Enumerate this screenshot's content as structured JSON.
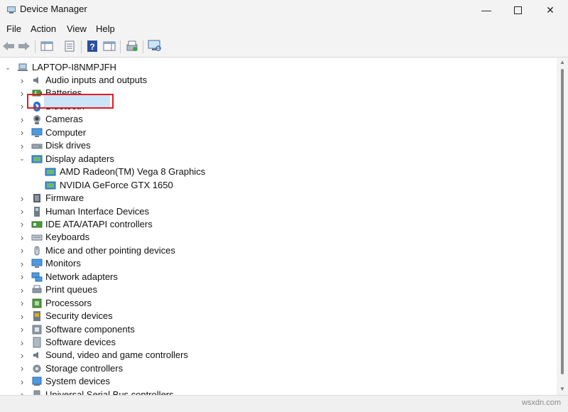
{
  "window": {
    "title": "Device Manager"
  },
  "menu": [
    "File",
    "Action",
    "View",
    "Help"
  ],
  "tree": {
    "root": "LAPTOP-I8NMPJFH",
    "categories": [
      {
        "label": "Audio inputs and outputs",
        "icon": "speaker-icon"
      },
      {
        "label": "Batteries",
        "icon": "battery-icon"
      },
      {
        "label": "Bluetooth",
        "icon": "bluetooth-icon"
      },
      {
        "label": "Cameras",
        "icon": "camera-icon"
      },
      {
        "label": "Computer",
        "icon": "computer-icon"
      },
      {
        "label": "Disk drives",
        "icon": "disk-drive-icon"
      },
      {
        "label": "Display adapters",
        "icon": "display-adapter-icon",
        "expanded": true,
        "selected": true,
        "children": [
          "AMD Radeon(TM) Vega 8 Graphics",
          "NVIDIA GeForce GTX 1650"
        ]
      },
      {
        "label": "Firmware",
        "icon": "firmware-icon"
      },
      {
        "label": "Human Interface Devices",
        "icon": "hid-icon"
      },
      {
        "label": "IDE ATA/ATAPI controllers",
        "icon": "ide-controller-icon"
      },
      {
        "label": "Keyboards",
        "icon": "keyboard-icon"
      },
      {
        "label": "Mice and other pointing devices",
        "icon": "mouse-icon"
      },
      {
        "label": "Monitors",
        "icon": "monitor-icon"
      },
      {
        "label": "Network adapters",
        "icon": "network-adapter-icon"
      },
      {
        "label": "Print queues",
        "icon": "printer-icon"
      },
      {
        "label": "Processors",
        "icon": "processor-icon"
      },
      {
        "label": "Security devices",
        "icon": "security-device-icon"
      },
      {
        "label": "Software components",
        "icon": "software-component-icon"
      },
      {
        "label": "Software devices",
        "icon": "software-device-icon"
      },
      {
        "label": "Sound, video and game controllers",
        "icon": "sound-icon"
      },
      {
        "label": "Storage controllers",
        "icon": "storage-controller-icon"
      },
      {
        "label": "System devices",
        "icon": "system-device-icon"
      },
      {
        "label": "Universal Serial Bus controllers",
        "icon": "usb-icon"
      }
    ]
  },
  "watermark": "wsxdn.com",
  "colors": {
    "selection": "#cce4f7",
    "highlight_border": "#e21b23"
  }
}
